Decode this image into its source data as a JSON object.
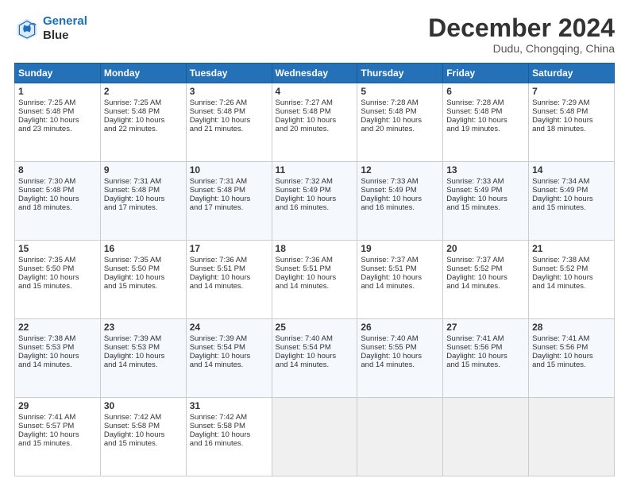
{
  "header": {
    "logo_line1": "General",
    "logo_line2": "Blue",
    "month": "December 2024",
    "location": "Dudu, Chongqing, China"
  },
  "days_of_week": [
    "Sunday",
    "Monday",
    "Tuesday",
    "Wednesday",
    "Thursday",
    "Friday",
    "Saturday"
  ],
  "weeks": [
    [
      {
        "day": "1",
        "info": "Sunrise: 7:25 AM\nSunset: 5:48 PM\nDaylight: 10 hours\nand 23 minutes."
      },
      {
        "day": "2",
        "info": "Sunrise: 7:25 AM\nSunset: 5:48 PM\nDaylight: 10 hours\nand 22 minutes."
      },
      {
        "day": "3",
        "info": "Sunrise: 7:26 AM\nSunset: 5:48 PM\nDaylight: 10 hours\nand 21 minutes."
      },
      {
        "day": "4",
        "info": "Sunrise: 7:27 AM\nSunset: 5:48 PM\nDaylight: 10 hours\nand 20 minutes."
      },
      {
        "day": "5",
        "info": "Sunrise: 7:28 AM\nSunset: 5:48 PM\nDaylight: 10 hours\nand 20 minutes."
      },
      {
        "day": "6",
        "info": "Sunrise: 7:28 AM\nSunset: 5:48 PM\nDaylight: 10 hours\nand 19 minutes."
      },
      {
        "day": "7",
        "info": "Sunrise: 7:29 AM\nSunset: 5:48 PM\nDaylight: 10 hours\nand 18 minutes."
      }
    ],
    [
      {
        "day": "8",
        "info": "Sunrise: 7:30 AM\nSunset: 5:48 PM\nDaylight: 10 hours\nand 18 minutes."
      },
      {
        "day": "9",
        "info": "Sunrise: 7:31 AM\nSunset: 5:48 PM\nDaylight: 10 hours\nand 17 minutes."
      },
      {
        "day": "10",
        "info": "Sunrise: 7:31 AM\nSunset: 5:48 PM\nDaylight: 10 hours\nand 17 minutes."
      },
      {
        "day": "11",
        "info": "Sunrise: 7:32 AM\nSunset: 5:49 PM\nDaylight: 10 hours\nand 16 minutes."
      },
      {
        "day": "12",
        "info": "Sunrise: 7:33 AM\nSunset: 5:49 PM\nDaylight: 10 hours\nand 16 minutes."
      },
      {
        "day": "13",
        "info": "Sunrise: 7:33 AM\nSunset: 5:49 PM\nDaylight: 10 hours\nand 15 minutes."
      },
      {
        "day": "14",
        "info": "Sunrise: 7:34 AM\nSunset: 5:49 PM\nDaylight: 10 hours\nand 15 minutes."
      }
    ],
    [
      {
        "day": "15",
        "info": "Sunrise: 7:35 AM\nSunset: 5:50 PM\nDaylight: 10 hours\nand 15 minutes."
      },
      {
        "day": "16",
        "info": "Sunrise: 7:35 AM\nSunset: 5:50 PM\nDaylight: 10 hours\nand 15 minutes."
      },
      {
        "day": "17",
        "info": "Sunrise: 7:36 AM\nSunset: 5:51 PM\nDaylight: 10 hours\nand 14 minutes."
      },
      {
        "day": "18",
        "info": "Sunrise: 7:36 AM\nSunset: 5:51 PM\nDaylight: 10 hours\nand 14 minutes."
      },
      {
        "day": "19",
        "info": "Sunrise: 7:37 AM\nSunset: 5:51 PM\nDaylight: 10 hours\nand 14 minutes."
      },
      {
        "day": "20",
        "info": "Sunrise: 7:37 AM\nSunset: 5:52 PM\nDaylight: 10 hours\nand 14 minutes."
      },
      {
        "day": "21",
        "info": "Sunrise: 7:38 AM\nSunset: 5:52 PM\nDaylight: 10 hours\nand 14 minutes."
      }
    ],
    [
      {
        "day": "22",
        "info": "Sunrise: 7:38 AM\nSunset: 5:53 PM\nDaylight: 10 hours\nand 14 minutes."
      },
      {
        "day": "23",
        "info": "Sunrise: 7:39 AM\nSunset: 5:53 PM\nDaylight: 10 hours\nand 14 minutes."
      },
      {
        "day": "24",
        "info": "Sunrise: 7:39 AM\nSunset: 5:54 PM\nDaylight: 10 hours\nand 14 minutes."
      },
      {
        "day": "25",
        "info": "Sunrise: 7:40 AM\nSunset: 5:54 PM\nDaylight: 10 hours\nand 14 minutes."
      },
      {
        "day": "26",
        "info": "Sunrise: 7:40 AM\nSunset: 5:55 PM\nDaylight: 10 hours\nand 14 minutes."
      },
      {
        "day": "27",
        "info": "Sunrise: 7:41 AM\nSunset: 5:56 PM\nDaylight: 10 hours\nand 15 minutes."
      },
      {
        "day": "28",
        "info": "Sunrise: 7:41 AM\nSunset: 5:56 PM\nDaylight: 10 hours\nand 15 minutes."
      }
    ],
    [
      {
        "day": "29",
        "info": "Sunrise: 7:41 AM\nSunset: 5:57 PM\nDaylight: 10 hours\nand 15 minutes."
      },
      {
        "day": "30",
        "info": "Sunrise: 7:42 AM\nSunset: 5:58 PM\nDaylight: 10 hours\nand 15 minutes."
      },
      {
        "day": "31",
        "info": "Sunrise: 7:42 AM\nSunset: 5:58 PM\nDaylight: 10 hours\nand 16 minutes."
      },
      {
        "day": "",
        "info": ""
      },
      {
        "day": "",
        "info": ""
      },
      {
        "day": "",
        "info": ""
      },
      {
        "day": "",
        "info": ""
      }
    ]
  ]
}
